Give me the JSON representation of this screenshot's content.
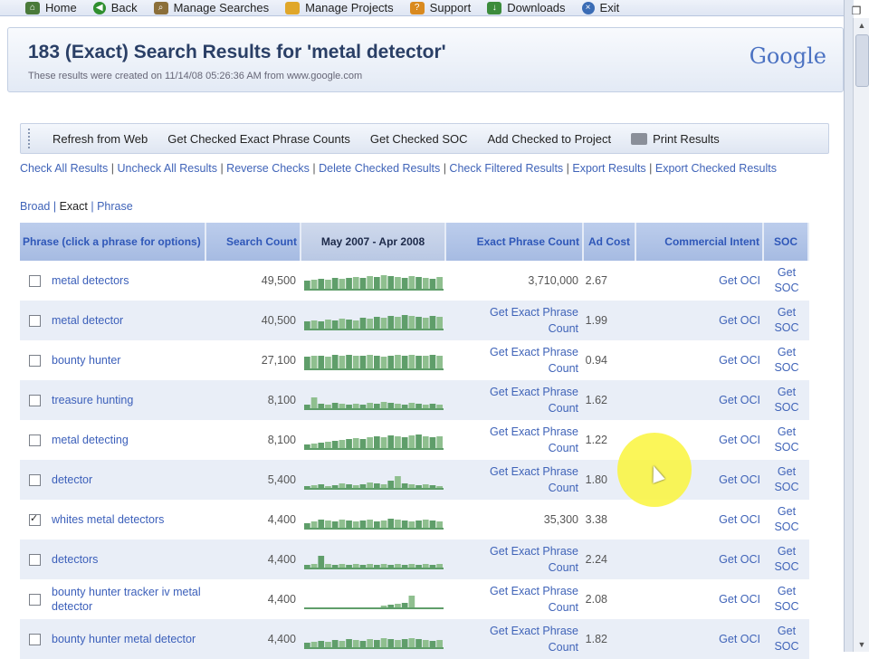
{
  "nav": {
    "items": [
      {
        "label": "Home",
        "icon": "home-icon"
      },
      {
        "label": "Back",
        "icon": "back-arrow-icon"
      },
      {
        "label": "Manage Searches",
        "icon": "magnifier-icon"
      },
      {
        "label": "Manage Projects",
        "icon": "folder-icon"
      },
      {
        "label": "Support",
        "icon": "support-icon"
      },
      {
        "label": "Downloads",
        "icon": "download-icon"
      },
      {
        "label": "Exit",
        "icon": "exit-icon"
      }
    ]
  },
  "header": {
    "title": "183 (Exact) Search Results for 'metal detector'",
    "subtitle": "These results were created on 11/14/08 05:26:36 AM from www.google.com",
    "logo": "Google"
  },
  "toolbar": {
    "refresh": "Refresh from Web",
    "exact_counts": "Get Checked Exact Phrase Counts",
    "soc": "Get Checked SOC",
    "add_project": "Add Checked to Project",
    "print": "Print Results"
  },
  "links": {
    "check_all": "Check All Results",
    "uncheck_all": "Uncheck All Results",
    "reverse": "Reverse Checks",
    "delete": "Delete Checked Results",
    "check_filtered": "Check Filtered Results",
    "export": "Export Results",
    "export_checked": "Export Checked Results",
    "sep": "|"
  },
  "match": {
    "broad": "Broad",
    "exact": "Exact",
    "phrase": "Phrase",
    "sep": "|"
  },
  "table": {
    "headers": {
      "phrase": "Phrase (click a phrase for options)",
      "count": "Search Count",
      "trend": "May 2007 - Apr 2008",
      "exact": "Exact Phrase Count",
      "ad": "Ad Cost",
      "ci": "Commercial Intent",
      "soc": "SOC"
    },
    "rows": [
      {
        "checked": false,
        "phrase": "metal detectors",
        "count": "49,500",
        "exact": "3,710,000",
        "ad": "2.67",
        "ci": "Get OCI",
        "soc": "Get SOC",
        "trend": [
          0.55,
          0.6,
          0.65,
          0.6,
          0.7,
          0.65,
          0.7,
          0.75,
          0.7,
          0.8,
          0.75,
          0.85,
          0.8,
          0.75,
          0.7,
          0.8,
          0.75,
          0.7,
          0.65,
          0.75
        ]
      },
      {
        "checked": false,
        "phrase": "metal detector",
        "count": "40,500",
        "exact": "Get Exact Phrase Count",
        "ad": "1.99",
        "ci": "Get OCI",
        "soc": "Get SOC",
        "trend": [
          0.5,
          0.55,
          0.5,
          0.6,
          0.55,
          0.65,
          0.6,
          0.55,
          0.7,
          0.65,
          0.75,
          0.7,
          0.8,
          0.75,
          0.85,
          0.8,
          0.75,
          0.7,
          0.8,
          0.75
        ]
      },
      {
        "checked": false,
        "phrase": "bounty hunter",
        "count": "27,100",
        "exact": "Get Exact Phrase Count",
        "ad": "0.94",
        "ci": "Get OCI",
        "soc": "Get SOC",
        "trend": [
          0.75,
          0.8,
          0.8,
          0.75,
          0.85,
          0.8,
          0.85,
          0.8,
          0.8,
          0.85,
          0.8,
          0.75,
          0.8,
          0.85,
          0.8,
          0.85,
          0.8,
          0.8,
          0.85,
          0.8
        ]
      },
      {
        "checked": false,
        "phrase": "treasure hunting",
        "count": "8,100",
        "exact": "Get Exact Phrase Count",
        "ad": "1.62",
        "ci": "Get OCI",
        "soc": "Get SOC",
        "trend": [
          0.3,
          0.7,
          0.35,
          0.3,
          0.4,
          0.35,
          0.3,
          0.35,
          0.3,
          0.4,
          0.35,
          0.45,
          0.4,
          0.35,
          0.3,
          0.4,
          0.35,
          0.3,
          0.35,
          0.3
        ]
      },
      {
        "checked": false,
        "phrase": "metal detecting",
        "count": "8,100",
        "exact": "Get Exact Phrase Count",
        "ad": "1.22",
        "ci": "Get OCI",
        "soc": "Get SOC",
        "trend": [
          0.3,
          0.35,
          0.4,
          0.45,
          0.5,
          0.55,
          0.6,
          0.65,
          0.6,
          0.7,
          0.75,
          0.7,
          0.8,
          0.75,
          0.7,
          0.8,
          0.85,
          0.75,
          0.7,
          0.75
        ]
      },
      {
        "checked": false,
        "phrase": "detector",
        "count": "5,400",
        "exact": "Get Exact Phrase Count",
        "ad": "1.80",
        "ci": "Get OCI",
        "soc": "Get SOC",
        "trend": [
          0.2,
          0.25,
          0.3,
          0.2,
          0.25,
          0.35,
          0.3,
          0.25,
          0.3,
          0.4,
          0.35,
          0.3,
          0.5,
          0.75,
          0.35,
          0.3,
          0.25,
          0.3,
          0.25,
          0.2
        ]
      },
      {
        "checked": true,
        "phrase": "whites metal detectors",
        "count": "4,400",
        "exact": "35,300",
        "ad": "3.38",
        "ci": "Get OCI",
        "soc": "Get SOC",
        "trend": [
          0.35,
          0.45,
          0.55,
          0.5,
          0.45,
          0.55,
          0.5,
          0.45,
          0.5,
          0.55,
          0.45,
          0.5,
          0.6,
          0.55,
          0.5,
          0.45,
          0.5,
          0.55,
          0.5,
          0.45
        ]
      },
      {
        "checked": false,
        "phrase": "detectors",
        "count": "4,400",
        "exact": "Get Exact Phrase Count",
        "ad": "2.24",
        "ci": "Get OCI",
        "soc": "Get SOC",
        "trend": [
          0.25,
          0.3,
          0.75,
          0.3,
          0.25,
          0.3,
          0.25,
          0.3,
          0.25,
          0.3,
          0.25,
          0.3,
          0.25,
          0.3,
          0.25,
          0.3,
          0.25,
          0.3,
          0.25,
          0.3
        ]
      },
      {
        "checked": false,
        "phrase": "bounty hunter tracker iv metal detector",
        "count": "4,400",
        "exact": "Get Exact Phrase Count",
        "ad": "2.08",
        "ci": "Get OCI",
        "soc": "Get SOC",
        "trend": [
          0.1,
          0.1,
          0.1,
          0.1,
          0.1,
          0.1,
          0.1,
          0.1,
          0.1,
          0.1,
          0.1,
          0.2,
          0.25,
          0.3,
          0.35,
          0.75,
          0.1,
          0.1,
          0.1,
          0.1
        ]
      },
      {
        "checked": false,
        "phrase": "bounty hunter metal detector",
        "count": "4,400",
        "exact": "Get Exact Phrase Count",
        "ad": "1.82",
        "ci": "Get OCI",
        "soc": "Get SOC",
        "trend": [
          0.35,
          0.4,
          0.45,
          0.4,
          0.5,
          0.45,
          0.55,
          0.5,
          0.45,
          0.55,
          0.5,
          0.6,
          0.55,
          0.5,
          0.55,
          0.6,
          0.55,
          0.5,
          0.45,
          0.5
        ]
      }
    ]
  },
  "colors": {
    "spark": "#8fbf8f",
    "spark_dark": "#5f9e6a",
    "link": "#3f63b8",
    "header_bg": "#b0c3e7"
  }
}
